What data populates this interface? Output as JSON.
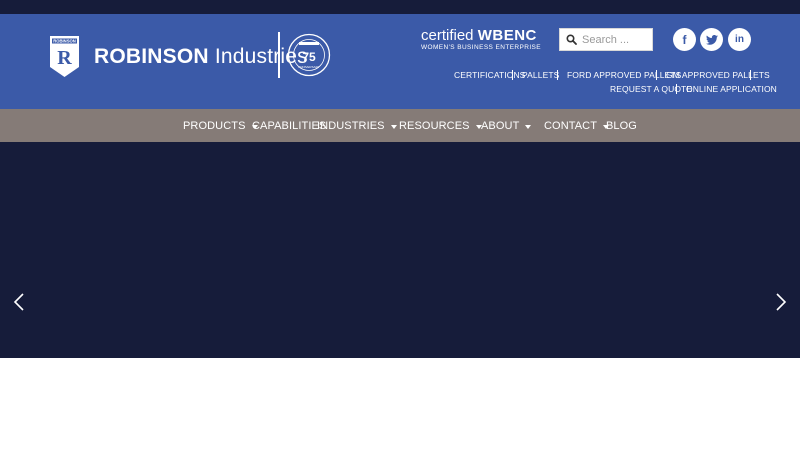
{
  "brand": {
    "name_bold": "ROBINSON",
    "name_light": "Industries",
    "shield_text": "ROBINSON",
    "shield_letter": "R",
    "anniversary": "75",
    "anniversary_text": "ANNIVERSARY"
  },
  "certification": {
    "prefix": "certified",
    "name": "WBENC",
    "subtitle": "WOMEN'S BUSINESS ENTERPRISE"
  },
  "search": {
    "placeholder": "Search ..."
  },
  "social": [
    {
      "icon": "facebook-icon",
      "glyph": "f"
    },
    {
      "icon": "twitter-icon",
      "glyph": "t"
    },
    {
      "icon": "linkedin-icon",
      "glyph": "in"
    }
  ],
  "utility_nav": {
    "row1": [
      "CERTIFICATIONS",
      "PALLETS",
      "FORD APPROVED PALLETS",
      "GM APPROVED PALLETS"
    ],
    "row2": [
      "REQUEST A QUOTE",
      "ONLINE APPLICATION"
    ]
  },
  "main_nav": [
    {
      "label": "PRODUCTS",
      "dropdown": true
    },
    {
      "label": "CAPABILITIES",
      "dropdown": false
    },
    {
      "label": "INDUSTRIES",
      "dropdown": true
    },
    {
      "label": "RESOURCES",
      "dropdown": true
    },
    {
      "label": "ABOUT",
      "dropdown": true
    },
    {
      "label": "CONTACT",
      "dropdown": true
    },
    {
      "label": "BLOG",
      "dropdown": false
    }
  ],
  "colors": {
    "header_blue": "#3b5aa8",
    "dark_navy": "#161c3a",
    "nav_taupe": "#857b77"
  }
}
